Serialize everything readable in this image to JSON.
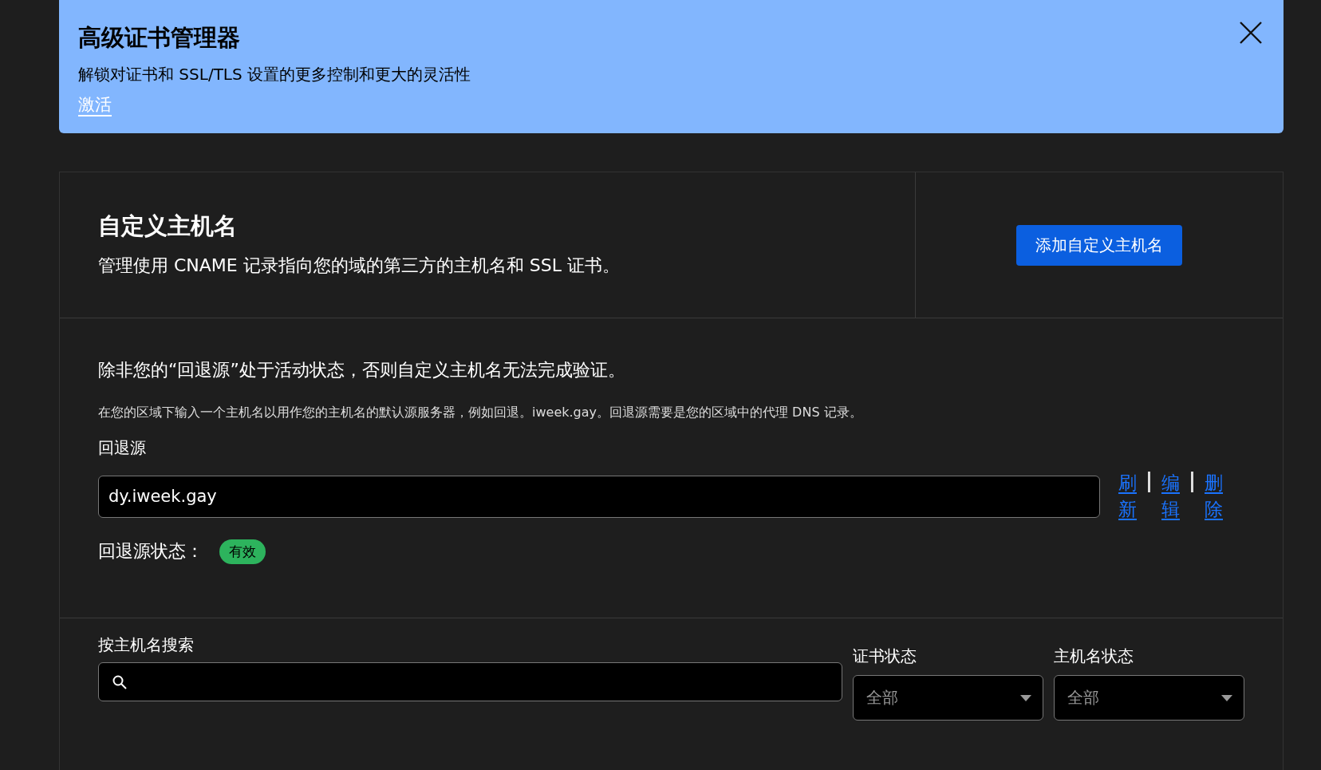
{
  "banner": {
    "title": "高级证书管理器",
    "description": "解锁对证书和 SSL/TLS 设置的更多控制和更大的灵活性",
    "link": "激活"
  },
  "header": {
    "title": "自定义主机名",
    "description": "管理使用 CNAME 记录指向您的域的第三方的主机名和 SSL 证书。",
    "button": "添加自定义主机名"
  },
  "fallback": {
    "warning": "除非您的“回退源”处于活动状态，否则自定义主机名无法完成验证。",
    "hint": "在您的区域下输入一个主机名以用作您的主机名的默认源服务器，例如回退。iweek.gay。回退源需要是您的区域中的代理 DNS 记录。",
    "label": "回退源",
    "value": "dy.iweek.gay",
    "actions": [
      "刷新",
      "编辑",
      "删除"
    ],
    "status_label": "回退源状态：",
    "status": {
      "text": "有效",
      "color": "#2db35d"
    }
  },
  "filters": {
    "search_label": "按主机名搜索",
    "selects": [
      {
        "label": "证书状态",
        "value": "全部"
      },
      {
        "label": "主机名状态",
        "value": "全部"
      }
    ]
  }
}
